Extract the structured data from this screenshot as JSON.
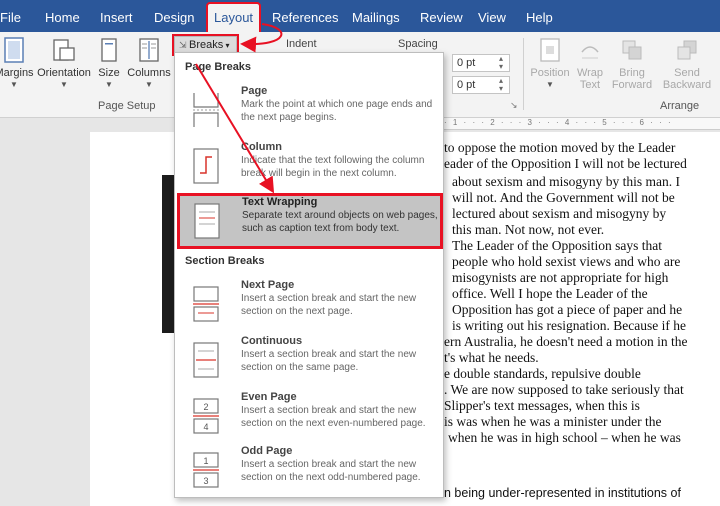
{
  "tabs": [
    {
      "label": "File"
    },
    {
      "label": "Home"
    },
    {
      "label": "Insert"
    },
    {
      "label": "Design"
    },
    {
      "label": "Layout"
    },
    {
      "label": "References"
    },
    {
      "label": "Mailings"
    },
    {
      "label": "Review"
    },
    {
      "label": "View"
    },
    {
      "label": "Help"
    }
  ],
  "ribbon": {
    "margins": "Margins",
    "orientation": "Orientation",
    "size": "Size",
    "columns": "Columns",
    "breaks": "Breaks",
    "indent": "Indent",
    "spacing": "Spacing",
    "spacing_before": "0 pt",
    "spacing_after": "0 pt",
    "page_setup": "Page Setup",
    "position": "Position",
    "wrap_text": "Wrap",
    "wrap_text2": "Text",
    "bring_forward": "Bring",
    "bring_forward2": "Forward",
    "send_backward": "Send",
    "send_backward2": "Backward",
    "arrange": "Arrange"
  },
  "menu": {
    "page_breaks_header": "Page Breaks",
    "section_breaks_header": "Section Breaks",
    "items": [
      {
        "title": "Page",
        "desc": "Mark the point at which one page ends and the next page begins."
      },
      {
        "title": "Column",
        "desc": "Indicate that the text following the column break will begin in the next column."
      },
      {
        "title": "Text Wrapping",
        "desc": "Separate text around objects on web pages, such as caption text from body text."
      },
      {
        "title": "Next Page",
        "desc": "Insert a section break and start the new section on the next page."
      },
      {
        "title": "Continuous",
        "desc": "Insert a section break and start the new section on the same page."
      },
      {
        "title": "Even Page",
        "desc": "Insert a section break and start the new section on the next even-numbered page."
      },
      {
        "title": "Odd Page",
        "desc": "Insert a section break and start the new section on the next odd-numbered page."
      }
    ]
  },
  "document": {
    "lines": [
      "to oppose the motion moved by the Leader",
      "eader of the Opposition I will not be lectured",
      "about sexism and misogyny by this man. I",
      "will not. And the Government will not be",
      "lectured about sexism and misogyny by",
      "this man. Not now, not ever.",
      "The Leader of the Opposition says that",
      "people who hold sexist views and who are",
      "misogynists are not appropriate for high",
      "office. Well I hope the Leader of the",
      "Opposition has got a piece of paper and he",
      "is writing out his resignation. Because if he",
      "ern Australia, he doesn't need a motion in the",
      "t's what he needs.",
      "e double standards, repulsive double",
      ". We are now supposed to take seriously that",
      "Slipper's text messages, when this is",
      "is was when he was a minister under the",
      "when he was in high school – when he was",
      "n being under-represented in institutions of"
    ]
  },
  "colors": {
    "word_blue": "#2b579a",
    "annotation_red": "#e81123",
    "selected_item_bg": "#c4c4c4"
  }
}
